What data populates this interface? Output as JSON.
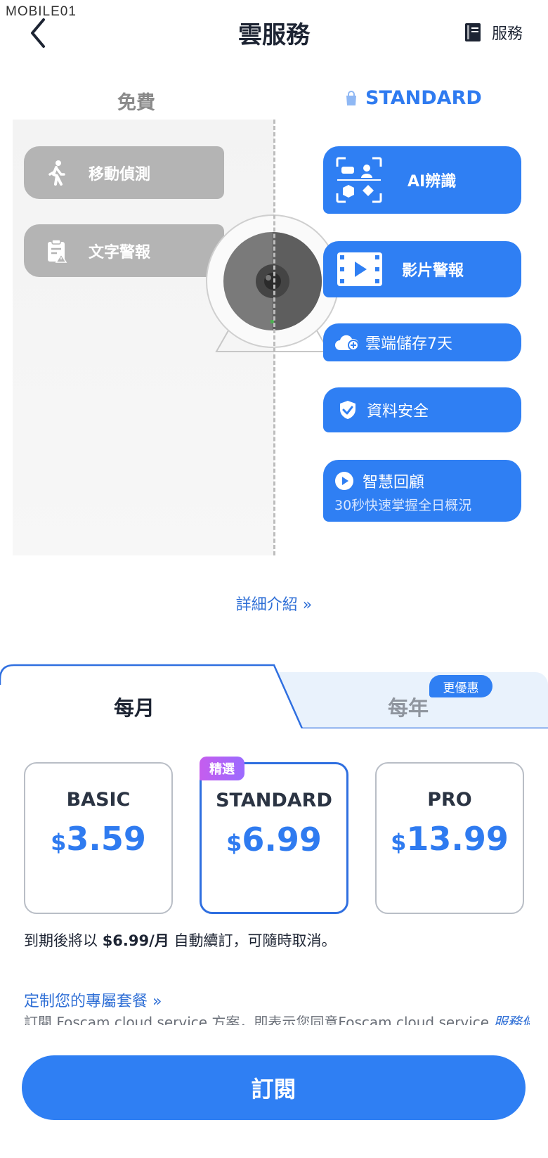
{
  "watermark": "MOBILE01",
  "header": {
    "title": "雲服務",
    "service_label": "服務",
    "back_icon": "chevron-left-icon",
    "service_icon": "book-icon"
  },
  "compare": {
    "free_header": "免費",
    "standard_header": "STANDARD",
    "free_features": [
      {
        "label": "移動偵測",
        "icon": "walking-person-icon"
      },
      {
        "label": "文字警報",
        "icon": "clipboard-alert-icon"
      }
    ],
    "standard_features": [
      {
        "label": "AI辨識",
        "icon": "ai-recognition-icon"
      },
      {
        "label": "影片警報",
        "icon": "video-film-icon"
      },
      {
        "label": "雲端儲存7天",
        "icon": "cloud-add-icon"
      },
      {
        "label": "資料安全",
        "icon": "shield-check-icon"
      },
      {
        "label": "智慧回顧",
        "sublabel": "30秒快速掌握全日概況",
        "icon": "play-circle-icon"
      }
    ]
  },
  "detail_link": "詳細介紹 »",
  "tabs": {
    "monthly": "每月",
    "yearly": "每年",
    "yearly_badge": "更優惠",
    "active": "monthly"
  },
  "plans": [
    {
      "name": "BASIC",
      "currency": "$",
      "price": "3.59"
    },
    {
      "name": "STANDARD",
      "currency": "$",
      "price": "6.99",
      "badge": "精選",
      "selected": true
    },
    {
      "name": "PRO",
      "currency": "$",
      "price": "13.99"
    }
  ],
  "renewal": {
    "prefix": "到期後將以 ",
    "amount": "$6.99/月",
    "suffix": " 自動續訂，可隨時取消。"
  },
  "custom_link": "定制您的專屬套餐 »",
  "terms": {
    "text": "訂閱 Foscam cloud service 方案，即表示您同意Foscam cloud service ",
    "link": "服務條"
  },
  "subscribe_button": "訂閱",
  "colors": {
    "accent": "#2f7ff3",
    "free_gray": "#b4b4b4",
    "badge_purple": "#b35ef0"
  }
}
